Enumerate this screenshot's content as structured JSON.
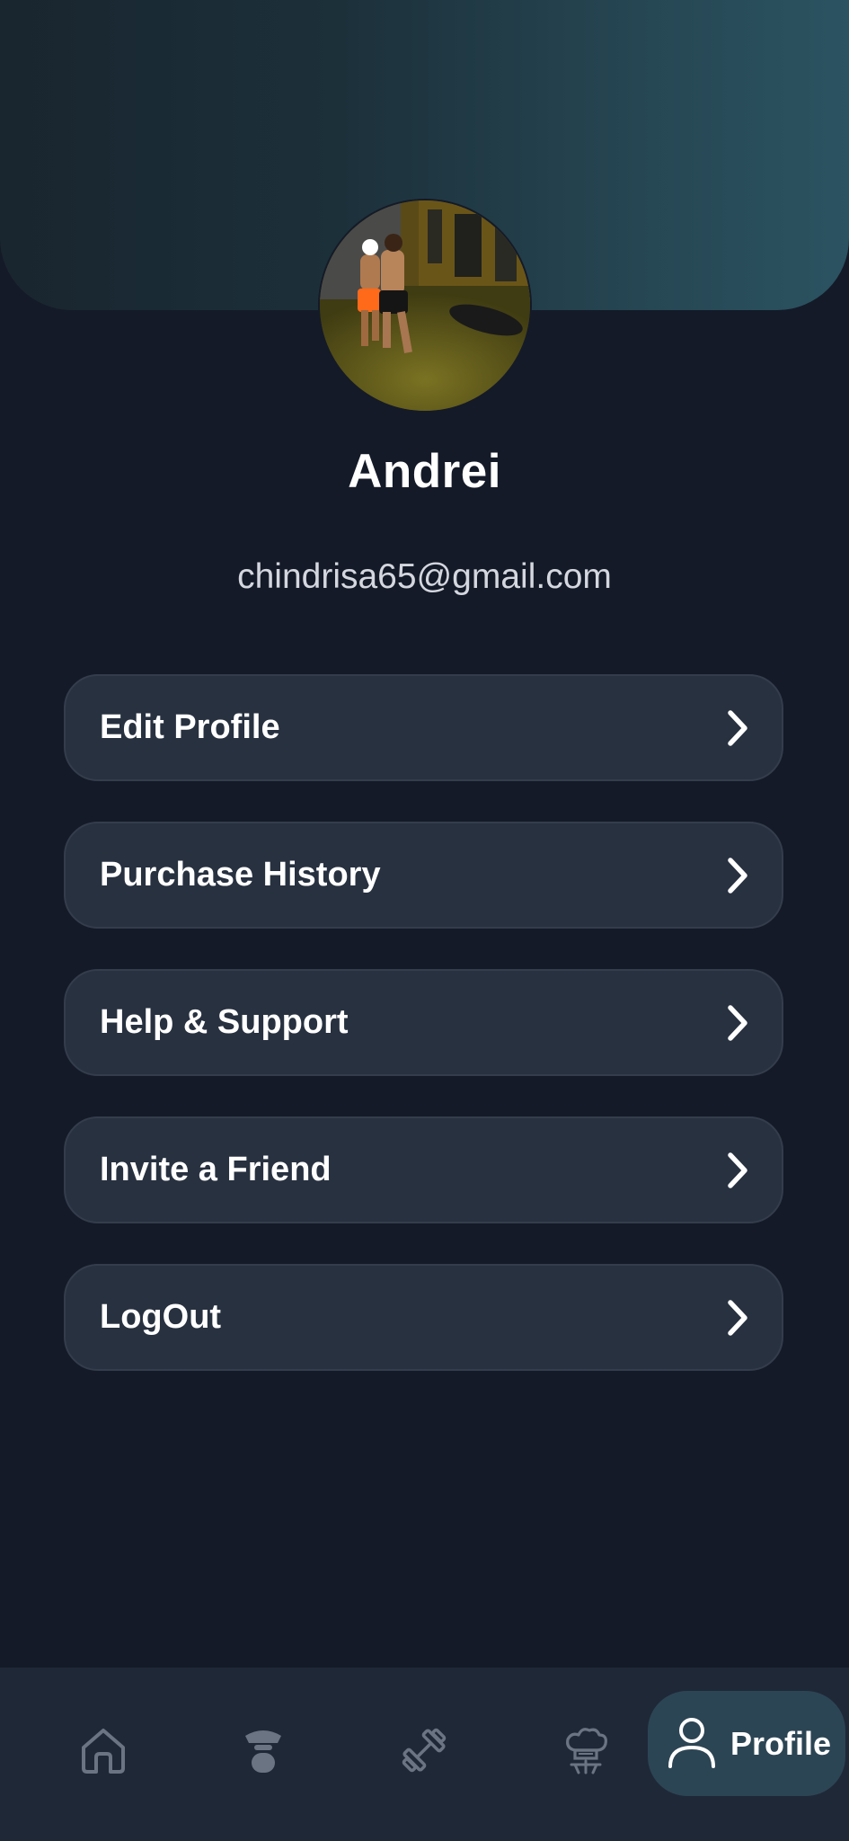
{
  "profile": {
    "name": "Andrei",
    "email": "chindrisa65@gmail.com"
  },
  "menu": {
    "items": [
      {
        "label": "Edit Profile",
        "icon": "chevron-right-icon"
      },
      {
        "label": "Purchase History",
        "icon": "chevron-right-icon"
      },
      {
        "label": "Help & Support",
        "icon": "chevron-right-icon"
      },
      {
        "label": "Invite a Friend",
        "icon": "chevron-right-icon"
      },
      {
        "label": "LogOut",
        "icon": "chevron-right-icon"
      }
    ]
  },
  "nav": {
    "items": [
      {
        "id": "home",
        "icon": "home-icon"
      },
      {
        "id": "trainer",
        "icon": "trainer-icon"
      },
      {
        "id": "workout",
        "icon": "dumbbell-icon"
      },
      {
        "id": "nutrition",
        "icon": "chef-hat-icon"
      }
    ],
    "active": {
      "label": "Profile",
      "icon": "user-icon"
    }
  },
  "colors": {
    "background": "#141a28",
    "card": "#283140",
    "card_border": "#343d4c",
    "nav_background": "#1f2837",
    "nav_active": "#2c4554",
    "header_gradient_start": "#19252f",
    "header_gradient_end": "#2b5361",
    "nav_icon_inactive": "#6b7482",
    "text_primary": "#ffffff",
    "text_secondary": "#d4d7de"
  }
}
